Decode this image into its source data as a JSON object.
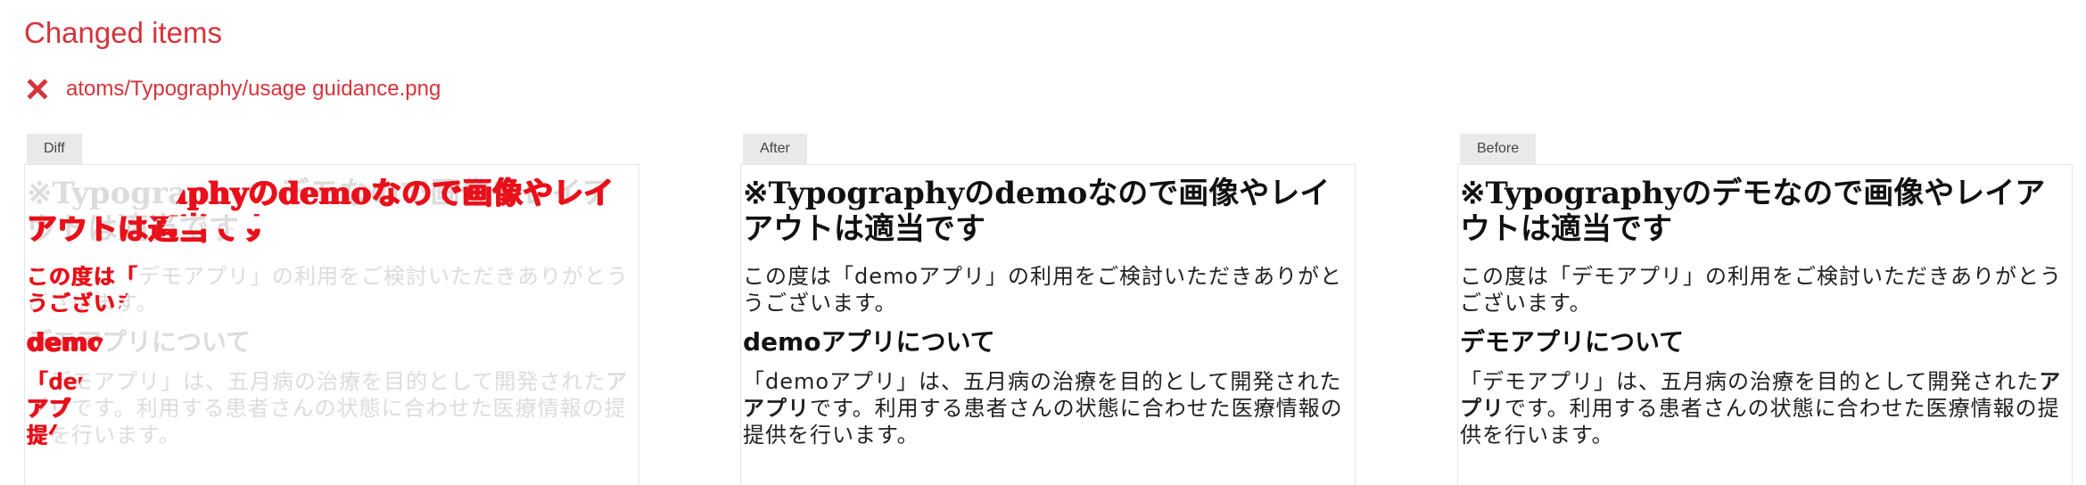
{
  "header": {
    "title": "Changed items"
  },
  "changed_item": {
    "status_icon": "x-mark-icon",
    "status_color": "#d4343b",
    "path": "atoms/Typography/usage guidance.png"
  },
  "panels": {
    "diff_label": "Diff",
    "after_label": "After",
    "before_label": "Before"
  },
  "after": {
    "heading": "※Typographyのdemoなので画像やレイアウトは適当です",
    "intro": "この度は「demoアプリ」の利用をご検討いただきありがとうございます。",
    "subheading": "demoアプリについて",
    "body_pre": "「demoアプリ」は、五月病の治療を目的として開発された",
    "body_strong": "アプリ",
    "body_post": "です。利用する患者さんの状態に合わせた医療情報の提供を行います。"
  },
  "before": {
    "heading": "※Typographyのデモなので画像やレイアウトは適当です",
    "intro": "この度は「デモアプリ」の利用をご検討いただきありがとうございます。",
    "subheading": "デモアプリについて",
    "body_pre": "「デモアプリ」は、五月病の治療を目的として開発された",
    "body_strong": "アプリ",
    "body_post": "です。利用する患者さんの状態に合わせた医療情報の提供を行います。"
  },
  "colors": {
    "accent": "#d4343b",
    "diff_highlight": "#e8101a"
  }
}
